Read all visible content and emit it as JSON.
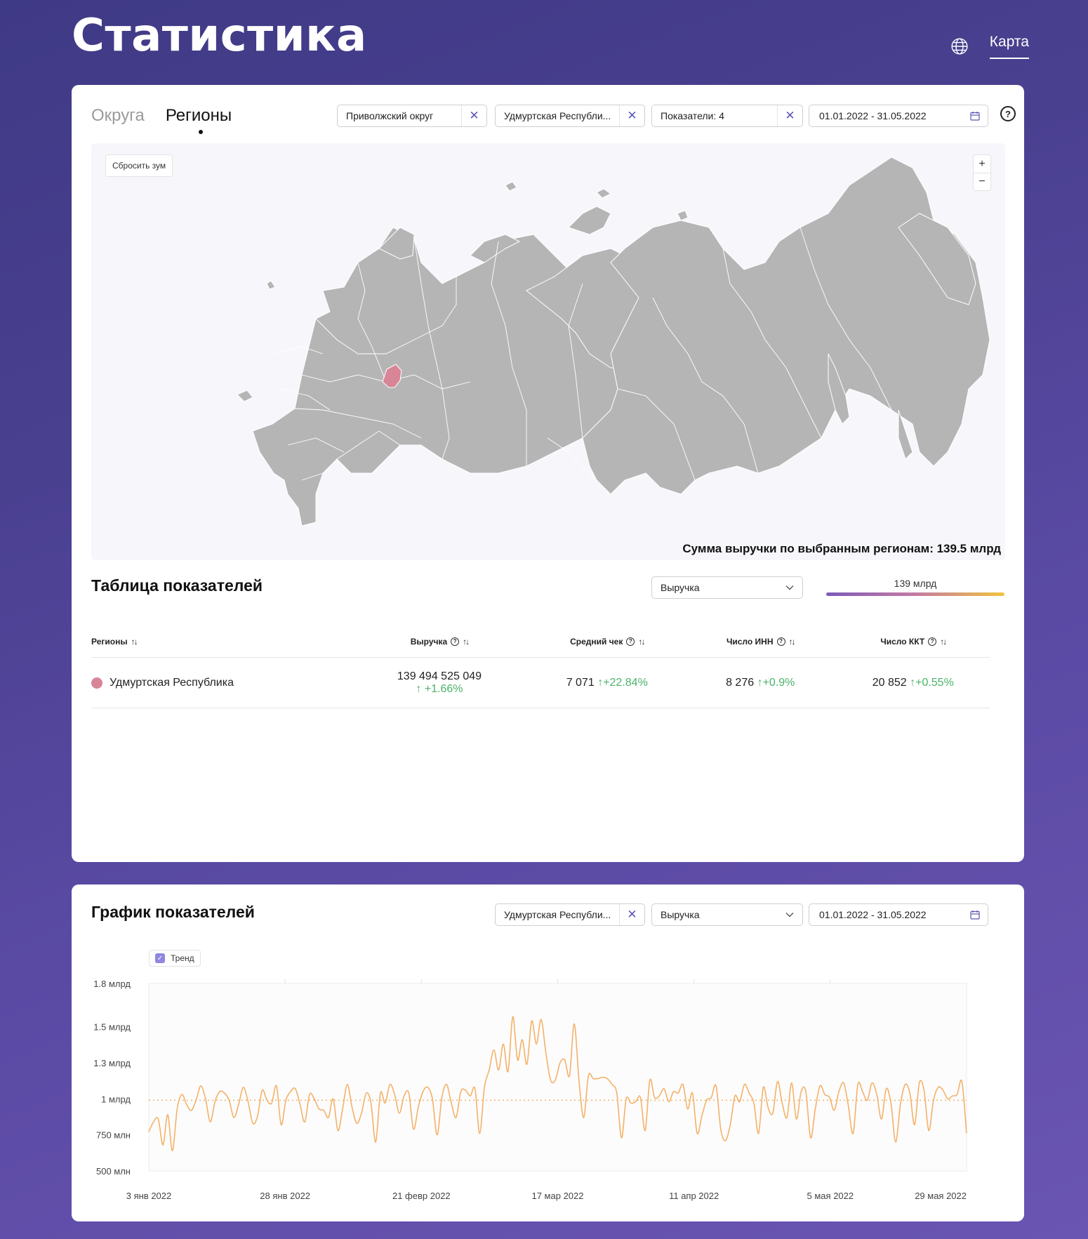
{
  "header": {
    "title": "Статистика",
    "nav_link": "Карта"
  },
  "map_card": {
    "tabs": [
      {
        "label": "Округа",
        "active": false
      },
      {
        "label": "Регионы",
        "active": true
      }
    ],
    "filters": {
      "district": "Приволжский округ",
      "region": "Удмуртская Республи...",
      "indicators": "Показатели: 4",
      "date_range": "01.01.2022 - 31.05.2022"
    },
    "help_icon": "?",
    "map": {
      "reset_zoom": "Сбросить зум",
      "zoom_in": "+",
      "zoom_out": "−",
      "sum_text": "Сумма выручки по выбранным регионам: 139.5 млрд",
      "highlight_color": "#d88597",
      "land_color": "#b5b5b5"
    }
  },
  "table": {
    "title": "Таблица показателей",
    "metric_select": "Выручка",
    "legend_value": "139 млрд",
    "headers": {
      "region": "Регионы",
      "revenue": "Выручка",
      "avg_check": "Средний чек",
      "inn_count": "Число ИНН",
      "kkt_count": "Число ККТ"
    },
    "rows": [
      {
        "region": "Удмуртская Республика",
        "revenue": "139 494 525 049",
        "revenue_delta": "+1.66%",
        "avg_check": "7 071",
        "avg_check_delta": "+22.84%",
        "inn": "8 276",
        "inn_delta": "+0.9%",
        "kkt": "20 852",
        "kkt_delta": "+0.55%"
      }
    ]
  },
  "chart_card": {
    "title": "График показателей",
    "filters": {
      "region": "Удмуртская Республи...",
      "metric": "Выручка",
      "date_range": "01.01.2022 - 31.05.2022"
    },
    "trend_label": "Тренд",
    "trend_checked": true
  },
  "chart_data": {
    "type": "line",
    "title": "",
    "xlabel": "",
    "ylabel": "",
    "y_tick_labels": [
      "1.8 млрд",
      "1.5 млрд",
      "1.3 млрд",
      "1 млрд",
      "750 млн",
      "500 млн"
    ],
    "y_ticks": [
      1800,
      1500,
      1250,
      1000,
      750,
      500
    ],
    "ylim": [
      500,
      1800
    ],
    "x_tick_labels": [
      "3 янв 2022",
      "28 янв 2022",
      "21 февр 2022",
      "17 мар 2022",
      "11 апр 2022",
      "5 мая 2022",
      "29 мая 2022"
    ],
    "x_start": "2022-01-01",
    "x_end": "2022-05-31",
    "line_color": "#f5b167",
    "trend_value": 990,
    "grid": true,
    "series": [
      {
        "values": [
          770,
          840,
          860,
          680,
          890,
          640,
          930,
          1030,
          960,
          920,
          990,
          1090,
          1000,
          840,
          980,
          1050,
          1040,
          990,
          870,
          960,
          1080,
          980,
          830,
          880,
          1060,
          990,
          970,
          1090,
          820,
          990,
          1050,
          1070,
          960,
          840,
          1030,
          1000,
          930,
          920,
          870,
          1000,
          780,
          930,
          1100,
          940,
          830,
          900,
          1040,
          970,
          700,
          1040,
          970,
          1100,
          1030,
          900,
          1020,
          1040,
          790,
          940,
          1050,
          1080,
          1000,
          750,
          1010,
          1100,
          970,
          870,
          1050,
          1060,
          1020,
          1070,
          760,
          1080,
          1200,
          1340,
          1200,
          1380,
          1190,
          1570,
          1270,
          1410,
          1240,
          1540,
          1380,
          1550,
          1320,
          1130,
          1130,
          1250,
          1270,
          1160,
          1520,
          1130,
          870,
          1160,
          1140,
          1140,
          1150,
          1140,
          1100,
          1040,
          730,
          1000,
          970,
          980,
          1010,
          780,
          1130,
          1010,
          1020,
          1070,
          980,
          1050,
          1040,
          1100,
          930,
          1040,
          760,
          880,
          990,
          1010,
          1090,
          790,
          710,
          820,
          1020,
          980,
          1100,
          1040,
          970,
          760,
          1080,
          940,
          900,
          1120,
          970,
          870,
          1110,
          860,
          1050,
          1050,
          730,
          930,
          1090,
          1030,
          1010,
          920,
          1050,
          1110,
          950,
          760,
          1100,
          1050,
          990,
          1110,
          1030,
          860,
          1070,
          970,
          700,
          960,
          1100,
          1040,
          820,
          1110,
          1060,
          780,
          990,
          1080,
          1060,
          1000,
          1020,
          1030,
          1120,
          760
        ]
      }
    ]
  }
}
